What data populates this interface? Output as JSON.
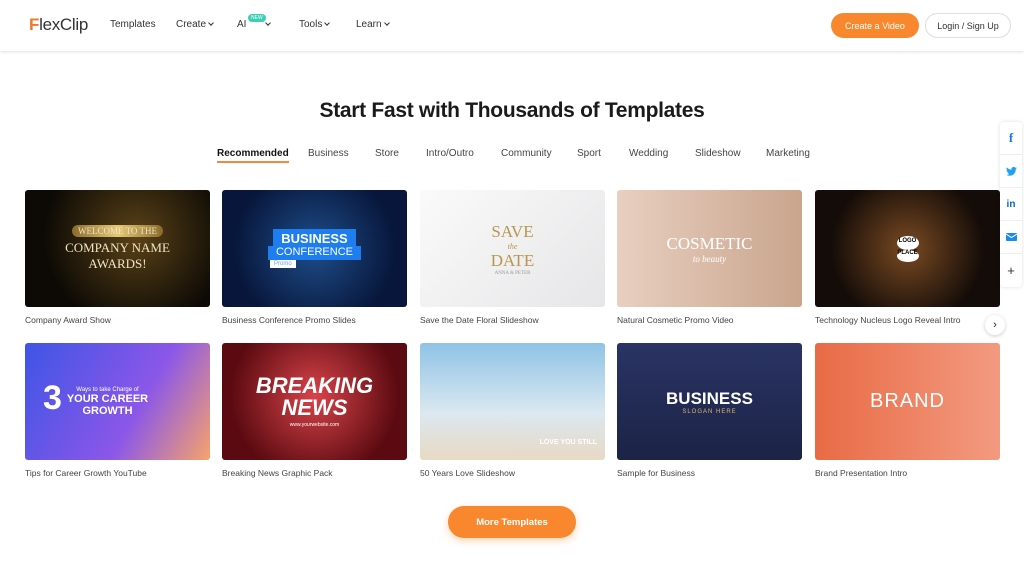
{
  "header": {
    "logo_prefix": "F",
    "logo_rest": "lexClip",
    "nav": [
      {
        "label": "Templates",
        "chevron": false
      },
      {
        "label": "Create",
        "chevron": true
      },
      {
        "label": "AI",
        "chevron": true,
        "badge": "NEW"
      },
      {
        "label": "Tools",
        "chevron": true
      },
      {
        "label": "Learn",
        "chevron": true
      }
    ],
    "create_button": "Create a Video",
    "login_button": "Login / Sign Up"
  },
  "main": {
    "title": "Start Fast with Thousands of Templates",
    "tabs": [
      "Recommended",
      "Business",
      "Store",
      "Intro/Outro",
      "Community",
      "Sport",
      "Wedding",
      "Slideshow",
      "Marketing"
    ],
    "active_tab": "Recommended",
    "templates": [
      {
        "caption": "Company Award Show",
        "thumb_lines": [
          "WELCOME TO THE",
          "COMPANY NAME",
          "AWARDS!"
        ]
      },
      {
        "caption": "Business Conference Promo Slides",
        "thumb_lines": [
          "BUSINESS",
          "CONFERENCE",
          "Promo"
        ]
      },
      {
        "caption": "Save the Date Floral Slideshow",
        "thumb_lines": [
          "SAVE",
          "the",
          "DATE",
          "ANNA & PETER"
        ]
      },
      {
        "caption": "Natural Cosmetic Promo Video",
        "thumb_lines": [
          "COSMETIC",
          "to beauty"
        ]
      },
      {
        "caption": "Technology Nucleus Logo Reveal Intro",
        "thumb_lines": [
          "LOGO",
          "PLACE"
        ]
      },
      {
        "caption": "Tips for Career Growth YouTube",
        "thumb_lines": [
          "3",
          "Ways to take Charge of",
          "YOUR CAREER",
          "GROWTH"
        ]
      },
      {
        "caption": "Breaking News Graphic Pack",
        "thumb_lines": [
          "BREAKING",
          "NEWS",
          "www.yourwebsite.com"
        ]
      },
      {
        "caption": "50 Years Love Slideshow",
        "thumb_lines": [
          "LOVE YOU STILL"
        ]
      },
      {
        "caption": "Sample for Business",
        "thumb_lines": [
          "BUSINESS",
          "SLOGAN HERE"
        ]
      },
      {
        "caption": "Brand Presentation Intro",
        "thumb_lines": [
          "BRAND"
        ]
      }
    ],
    "more_button": "More Templates"
  },
  "share": {
    "icons": [
      "facebook-icon",
      "twitter-icon",
      "linkedin-icon",
      "email-icon",
      "plus-icon"
    ],
    "labels": [
      "f",
      "t",
      "in",
      "✉",
      "+"
    ]
  },
  "colors": {
    "accent": "#f8872d",
    "tab_underline": "#f0883e",
    "badge": "#3ccfb4"
  }
}
